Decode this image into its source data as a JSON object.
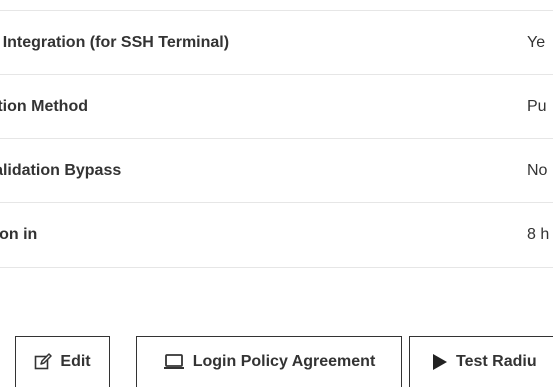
{
  "properties": [
    {
      "label": "",
      "value": ""
    },
    {
      "label": "l Key Integration (for SSH Terminal)",
      "value": "Ye"
    },
    {
      "label": "ntication Method",
      "value": "Pu"
    },
    {
      "label": "FA Validation Bypass",
      "value": "No"
    },
    {
      "label": "piration in",
      "value": "8 h"
    }
  ],
  "toolbar": {
    "edit_label": "Edit",
    "policy_label": "Login Policy Agreement",
    "test_label": "Test Radiu"
  },
  "icons": {
    "edit": "edit-icon",
    "policy": "laptop-icon",
    "test": "play-icon"
  }
}
